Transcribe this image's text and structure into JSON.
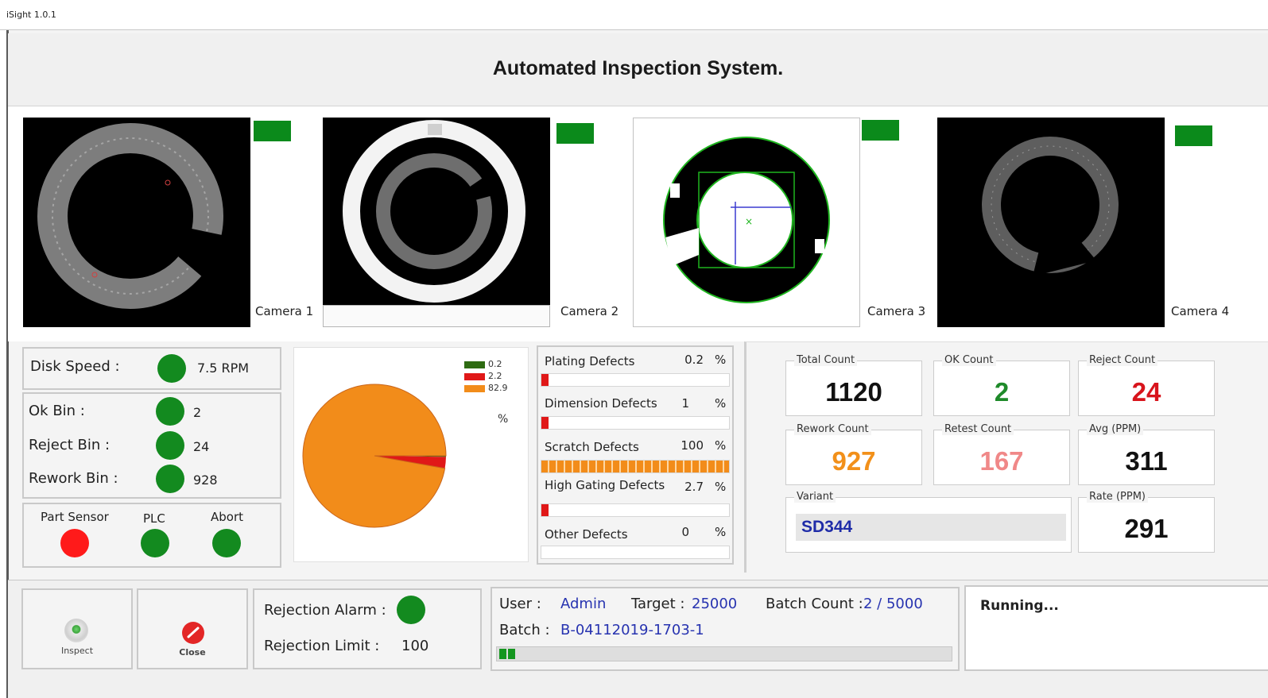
{
  "window": {
    "title": "iSight 1.0.1"
  },
  "header": {
    "title": "Automated Inspection System."
  },
  "cameras": [
    {
      "label": "Camera 1",
      "status_color": "#0b8a1b"
    },
    {
      "label": "Camera 2",
      "status_color": "#0b8a1b"
    },
    {
      "label": "Camera 3",
      "status_color": "#0b8a1b"
    },
    {
      "label": "Camera 4",
      "status_color": "#0b8a1b"
    }
  ],
  "machine": {
    "disk_speed": {
      "label": "Disk Speed :",
      "value": "7.5 RPM",
      "status": "green"
    },
    "bins": [
      {
        "label": "Ok Bin :",
        "value": "2",
        "status": "green"
      },
      {
        "label": "Reject Bin :",
        "value": "24",
        "status": "green"
      },
      {
        "label": "Rework Bin :",
        "value": "928",
        "status": "green"
      }
    ],
    "sensors": [
      {
        "label": "Part Sensor",
        "status": "red"
      },
      {
        "label": "PLC",
        "status": "green"
      },
      {
        "label": "Abort",
        "status": "green"
      }
    ]
  },
  "chart_data": {
    "type": "pie",
    "categories": [
      "0.2",
      "2.2",
      "82.9"
    ],
    "values": [
      0.2,
      2.2,
      82.9
    ],
    "colors": [
      "#2e6b12",
      "#e01818",
      "#f28c1a"
    ],
    "unit_label": "%"
  },
  "defects": [
    {
      "label": "Plating Defects",
      "value": "0.2",
      "unit": "%",
      "fill_pct": 0.2,
      "color": "red"
    },
    {
      "label": "Dimension Defects",
      "value": "1",
      "unit": "%",
      "fill_pct": 1,
      "color": "red"
    },
    {
      "label": "Scratch Defects",
      "value": "100",
      "unit": "%",
      "fill_pct": 100,
      "color": "orange"
    },
    {
      "label": "High Gating Defects",
      "value": "2.7",
      "unit": "%",
      "fill_pct": 2.7,
      "color": "red"
    },
    {
      "label": "Other Defects",
      "value": "0",
      "unit": "%",
      "fill_pct": 0,
      "color": "red"
    }
  ],
  "stats": {
    "total": {
      "label": "Total Count",
      "value": "1120",
      "color": "#111111"
    },
    "ok": {
      "label": "OK Count",
      "value": "2",
      "color": "#1f8a2a"
    },
    "reject": {
      "label": "Reject Count",
      "value": "24",
      "color": "#d8141c"
    },
    "rework": {
      "label": "Rework Count",
      "value": "927",
      "color": "#f2901a"
    },
    "retest": {
      "label": "Retest Count",
      "value": "167",
      "color": "#f08888"
    },
    "avg": {
      "label": "Avg (PPM)",
      "value": "311",
      "color": "#111111"
    },
    "variant": {
      "label": "Variant",
      "value": "SD344"
    },
    "rate": {
      "label": "Rate (PPM)",
      "value": "291",
      "color": "#111111"
    }
  },
  "buttons": {
    "inspect": {
      "label": "Inspect",
      "icon": "camera-lens-icon"
    },
    "close": {
      "label": "Close",
      "icon": "close-circle-icon"
    }
  },
  "rejection": {
    "alarm_label": "Rejection Alarm :",
    "alarm_status": "green",
    "limit_label": "Rejection Limit :",
    "limit_value": "100"
  },
  "session": {
    "user_label": "User :",
    "user_value": "Admin",
    "target_label": "Target :",
    "target_value": "25000",
    "batch_count_label": "Batch Count :",
    "batch_count_value": "2 / 5000",
    "batch_label": "Batch :",
    "batch_value": "B-04112019-1703-1",
    "progress_fraction": 0.0004
  },
  "status": {
    "text": "Running..."
  }
}
